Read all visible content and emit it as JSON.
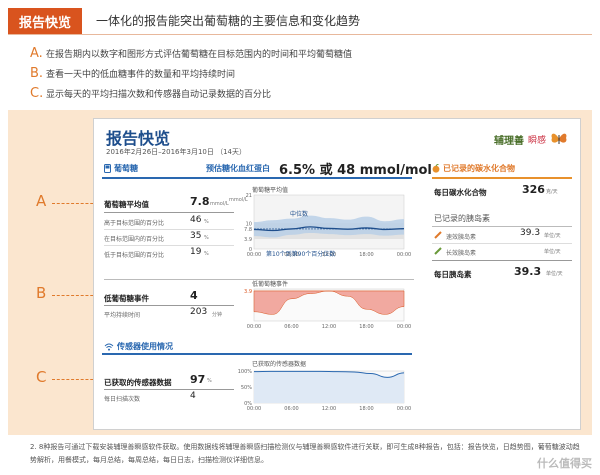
{
  "header": {
    "badge": "报告快览",
    "title": "一体化的报告能突出葡萄糖的主要信息和变化趋势"
  },
  "intro": [
    {
      "letter": "A.",
      "text": "在报告期内以数字和图形方式评估葡萄糖在目标范围内的时间和平均葡萄糖值"
    },
    {
      "letter": "B.",
      "text": "查看一天中的低血糖事件的数量和平均持续时间"
    },
    {
      "letter": "C.",
      "text": "显示每天的平均扫描次数和传感器自动记录数据的百分比"
    }
  ],
  "callouts": {
    "a": "A",
    "b": "B",
    "c": "C"
  },
  "report": {
    "title": "报告快览",
    "dates": "2016年2月26日–2016年3月10日",
    "days": "（14天）",
    "logo": {
      "brand": "辅理善",
      "brand2": "瞬感"
    },
    "glucose": {
      "heading": "葡萄糖",
      "a1c_label": "预估糖化血红蛋白",
      "a1c_value": "6.5% 或 48 mmol/mol",
      "avg_label": "葡萄糖平均值",
      "avg_value": "7.8",
      "avg_unit": "mmol/L",
      "rows": [
        {
          "label": "高于目标范围的百分比",
          "value": "46",
          "unit": "%"
        },
        {
          "label": "在目标范围内的百分比",
          "value": "35",
          "unit": "%"
        },
        {
          "label": "低于目标范围的百分比",
          "value": "19",
          "unit": "%"
        }
      ],
      "chart_title": "葡萄糖平均值",
      "chart_legend_median": "中位数",
      "chart_legend_band": "第10个到第90个百分位数",
      "y_unit": "mmol/L"
    },
    "low": {
      "events_label": "低葡萄糖事件",
      "events_value": "4",
      "duration_label": "平均持续时间",
      "duration_value": "203",
      "duration_unit": "分钟",
      "chart_title": "低葡萄糖事件"
    },
    "sensor": {
      "heading": "传感器使用情况",
      "captured_label": "已获取的传感器数据",
      "captured_value": "97",
      "captured_unit": "%",
      "scans_label": "每日扫描次数",
      "scans_value": "4",
      "chart_title": "已获取的传感器数据"
    },
    "carbs": {
      "heading": "已记录的碳水化合物",
      "daily_label": "每日碳水化合物",
      "daily_value": "326",
      "daily_unit": "克/天"
    },
    "insulin": {
      "heading": "已记录的胰岛素",
      "rapid_label": "速效胰岛素",
      "rapid_value": "39.3",
      "rapid_unit": "单位/天",
      "long_label": "长效胰岛素",
      "long_unit": "单位/天",
      "total_label": "每日胰岛素",
      "total_value": "39.3",
      "total_unit": "单位/天"
    }
  },
  "note": "2. 8种报告可通过下载安装辅理善瞬感软件获取。使用数据线将辅理善瞬感扫描检测仪与辅理善瞬感软件进行关联，即可生成8种报告，包括：报告快览，日趋势图，葡萄糖波动趋势解析，用餐模式，每月总结，每周总结，每日日志，扫描检测仪详细信息。",
  "watermark": "什么值得买",
  "chart_data": [
    {
      "type": "line",
      "title": "葡萄糖平均值",
      "x": [
        "00:00",
        "06:00",
        "12:00",
        "18:00",
        "00:00"
      ],
      "ylabel": "mmol/L",
      "yticks": [
        0,
        3.9,
        7.8,
        10,
        21
      ],
      "ylim": [
        0,
        21
      ],
      "series": [
        {
          "name": "中位数",
          "values": [
            7.6,
            7.2,
            7.8,
            8.6,
            8.0,
            7.7,
            8.2,
            7.6,
            7.9
          ]
        },
        {
          "name": "第10个到第90个百分位数",
          "values_low": [
            5.0,
            4.5,
            5.5,
            6.2,
            5.8,
            5.4,
            5.8,
            5.2,
            5.6
          ],
          "values_high": [
            10.5,
            11.2,
            11.8,
            13.0,
            12.0,
            11.4,
            12.6,
            10.8,
            11.6
          ]
        }
      ]
    },
    {
      "type": "area",
      "title": "低葡萄糖事件",
      "x": [
        "00:00",
        "06:00",
        "12:00",
        "18:00",
        "00:00"
      ],
      "yticks": [
        3.9
      ],
      "series": [
        {
          "name": "低葡萄糖",
          "values": [
            0.8,
            0.9,
            0.3,
            0.1,
            0.0,
            0.2,
            0.7,
            0.9,
            0.6
          ]
        }
      ]
    },
    {
      "type": "line",
      "title": "已获取的传感器数据",
      "x": [
        "00:00",
        "06:00",
        "12:00",
        "18:00",
        "00:00"
      ],
      "yticks": [
        "100%",
        "50%",
        "0%"
      ],
      "ylim": [
        0,
        100
      ],
      "series": [
        {
          "name": "已获取",
          "values": [
            98,
            99,
            99,
            99,
            99,
            98,
            97,
            92,
            80,
            94
          ]
        }
      ]
    }
  ]
}
